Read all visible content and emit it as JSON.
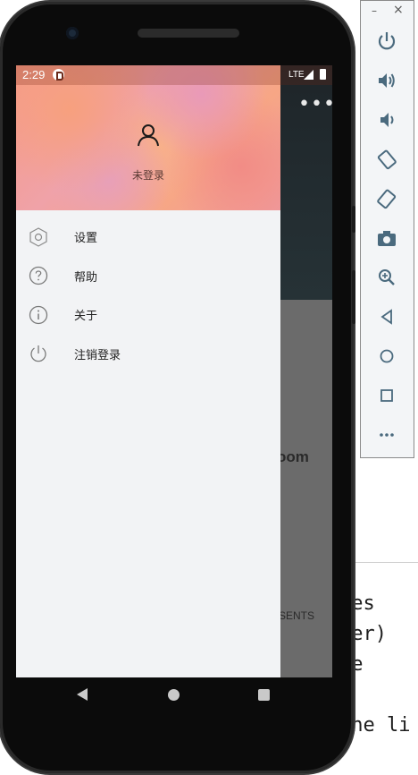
{
  "status_bar": {
    "time": "2:29",
    "network": "LTE"
  },
  "drawer": {
    "user_status": "未登录",
    "menu": [
      {
        "label": "设置",
        "icon": "settings-icon"
      },
      {
        "label": "帮助",
        "icon": "help-icon"
      },
      {
        "label": "关于",
        "icon": "info-icon"
      },
      {
        "label": "注销登录",
        "icon": "power-icon"
      }
    ]
  },
  "background_app": {
    "partial_title": "oom",
    "partial_tab": "SENTS"
  },
  "background_editor": {
    "lines": [
      "mes",
      "der)",
      "xe",
      "",
      "the li"
    ]
  },
  "emulator_toolbar": {
    "window_minimize": "–",
    "window_close": "×",
    "buttons": [
      "power-icon",
      "volume-up-icon",
      "volume-down-icon",
      "rotate-left-icon",
      "rotate-right-icon",
      "camera-icon",
      "zoom-icon",
      "back-icon",
      "home-icon",
      "overview-icon",
      "more-icon"
    ]
  },
  "colors": {
    "drawer_bg": "#f2f3f5",
    "app_bar": "#232d31",
    "scrim": "#6b6b6b",
    "accent_header": "#f59a86"
  }
}
